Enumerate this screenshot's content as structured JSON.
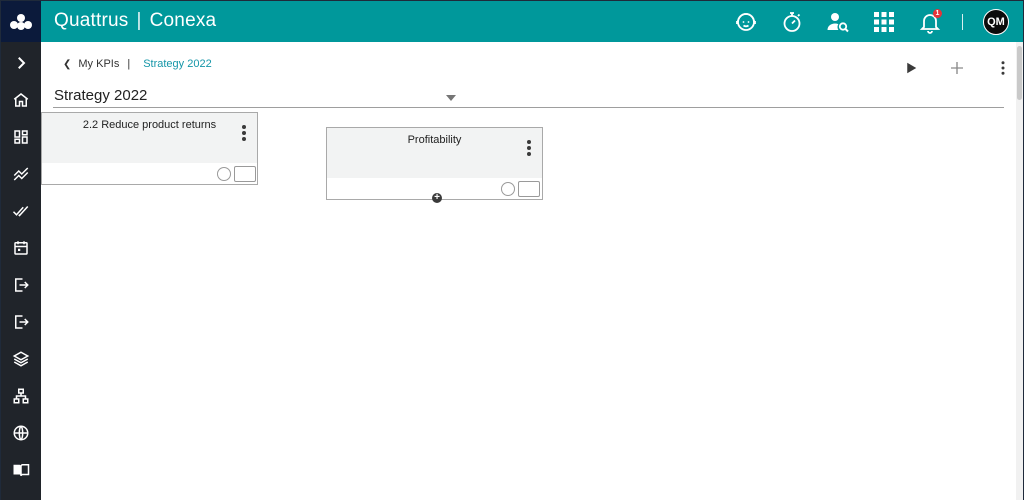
{
  "app": {
    "brand_left": "Quattrus",
    "brand_sep": "|",
    "brand_right": "Conexa",
    "notification_count": "1",
    "avatar_initials": "QM"
  },
  "icons": {
    "top": [
      "support-agent-icon",
      "timer-icon",
      "user-search-icon",
      "apps-grid-icon",
      "notifications-bell-icon"
    ],
    "sidebar": [
      "chevron-right-icon",
      "home-icon",
      "dashboard-icon",
      "trending-icon",
      "done-all-icon",
      "calendar-icon",
      "login-icon",
      "logout-icon",
      "layers-icon",
      "hierarchy-icon",
      "globe-icon",
      "book-icon"
    ]
  },
  "breadcrumb": {
    "back_label": "My KPIs",
    "separator": "|",
    "current": "Strategy 2022"
  },
  "header": {
    "title": "Strategy 2022"
  },
  "cards": [
    {
      "title": "2.2 Reduce product returns"
    },
    {
      "title": "Profitability",
      "add_child": "+"
    }
  ],
  "colors": {
    "topbar": "#00989b",
    "logo_bg": "#0b1a3b",
    "sidebar": "#20242a",
    "breadcrumb_current": "#1596a8",
    "notification_badge": "#e5343a"
  }
}
